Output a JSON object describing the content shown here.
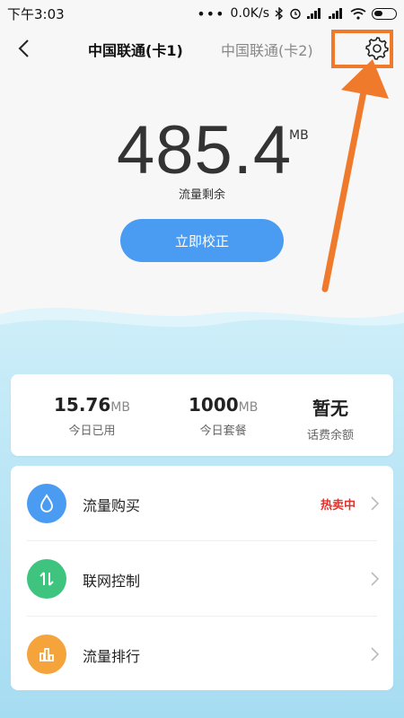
{
  "status_bar": {
    "time": "下午3:03",
    "net_speed": "0.0K/s"
  },
  "header": {
    "tabs": [
      {
        "label": "中国联通(卡1)",
        "active": true
      },
      {
        "label": "中国联通(卡2)",
        "active": false
      }
    ]
  },
  "usage": {
    "remaining_value": "485.4",
    "remaining_unit": "MB",
    "remaining_label": "流量剩余",
    "calibrate_label": "立即校正"
  },
  "stats": [
    {
      "value": "15.76",
      "unit": "MB",
      "label": "今日已用"
    },
    {
      "value": "1000",
      "unit": "MB",
      "label": "今日套餐"
    },
    {
      "value": "暂无",
      "unit": "",
      "label": "话费余额"
    }
  ],
  "menu": [
    {
      "label": "流量购买",
      "badge": "热卖中",
      "icon": "water-drop-icon",
      "color": "#4a9cf2"
    },
    {
      "label": "联网控制",
      "badge": "",
      "icon": "updown-arrows-icon",
      "color": "#3fc480"
    },
    {
      "label": "流量排行",
      "badge": "",
      "icon": "bar-chart-icon",
      "color": "#f5a33b"
    }
  ],
  "colors": {
    "accent": "#4a9cf2",
    "highlight": "#f07a2b",
    "badge": "#e3322b"
  }
}
